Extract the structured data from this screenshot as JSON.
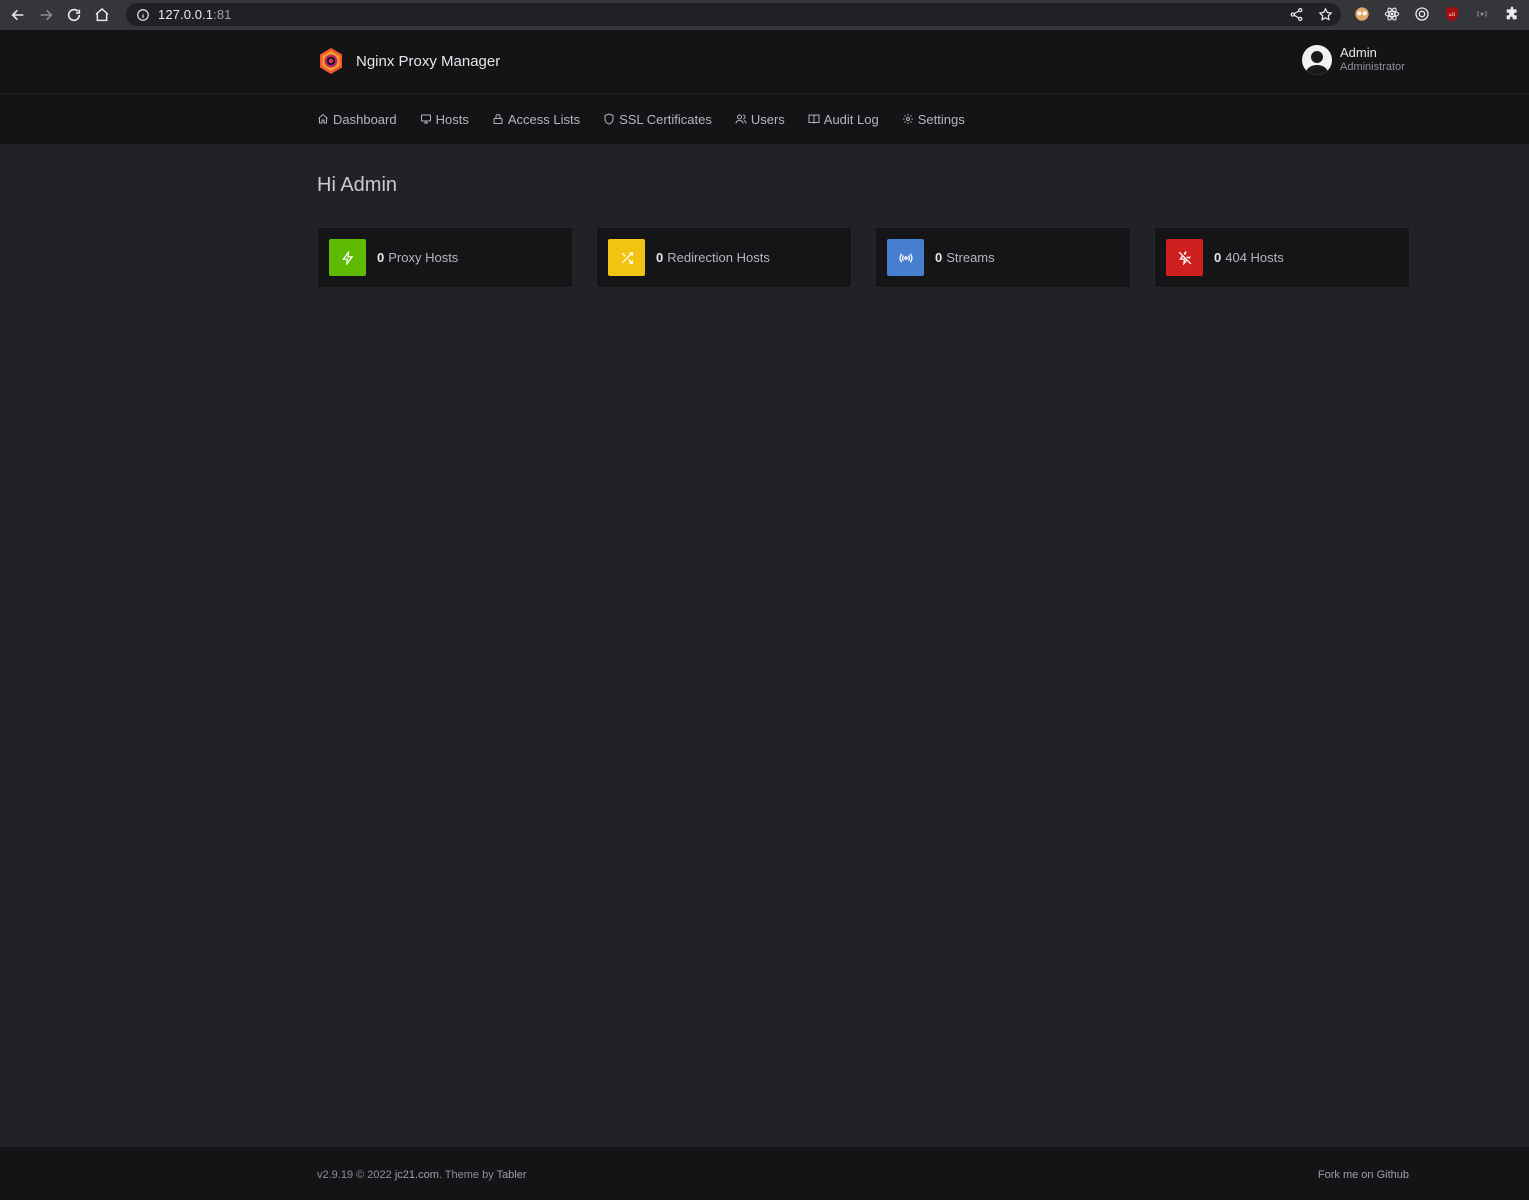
{
  "browser": {
    "url_host": "127.0.0.1",
    "url_port": ":81"
  },
  "header": {
    "app_name": "Nginx Proxy Manager",
    "user_name": "Admin",
    "user_role": "Administrator"
  },
  "nav": {
    "items": [
      {
        "label": "Dashboard",
        "icon": "home-icon"
      },
      {
        "label": "Hosts",
        "icon": "monitor-icon"
      },
      {
        "label": "Access Lists",
        "icon": "lock-icon"
      },
      {
        "label": "SSL Certificates",
        "icon": "shield-icon"
      },
      {
        "label": "Users",
        "icon": "users-icon"
      },
      {
        "label": "Audit Log",
        "icon": "book-icon"
      },
      {
        "label": "Settings",
        "icon": "gear-icon"
      }
    ]
  },
  "main": {
    "greeting": "Hi Admin",
    "stats": [
      {
        "count": "0",
        "label": "Proxy Hosts",
        "color": "#5eba00",
        "icon": "zap-icon"
      },
      {
        "count": "0",
        "label": "Redirection Hosts",
        "color": "#f1c40f",
        "icon": "shuffle-icon"
      },
      {
        "count": "0",
        "label": "Streams",
        "color": "#467fcf",
        "icon": "radio-icon"
      },
      {
        "count": "0",
        "label": "404 Hosts",
        "color": "#cd201f",
        "icon": "zap-off-icon"
      }
    ]
  },
  "footer": {
    "version_text": "v2.9.19 © 2022",
    "company_link": "jc21.com",
    "theme_text": ". Theme by",
    "theme_link": "Tabler",
    "github_link": "Fork me on Github"
  }
}
